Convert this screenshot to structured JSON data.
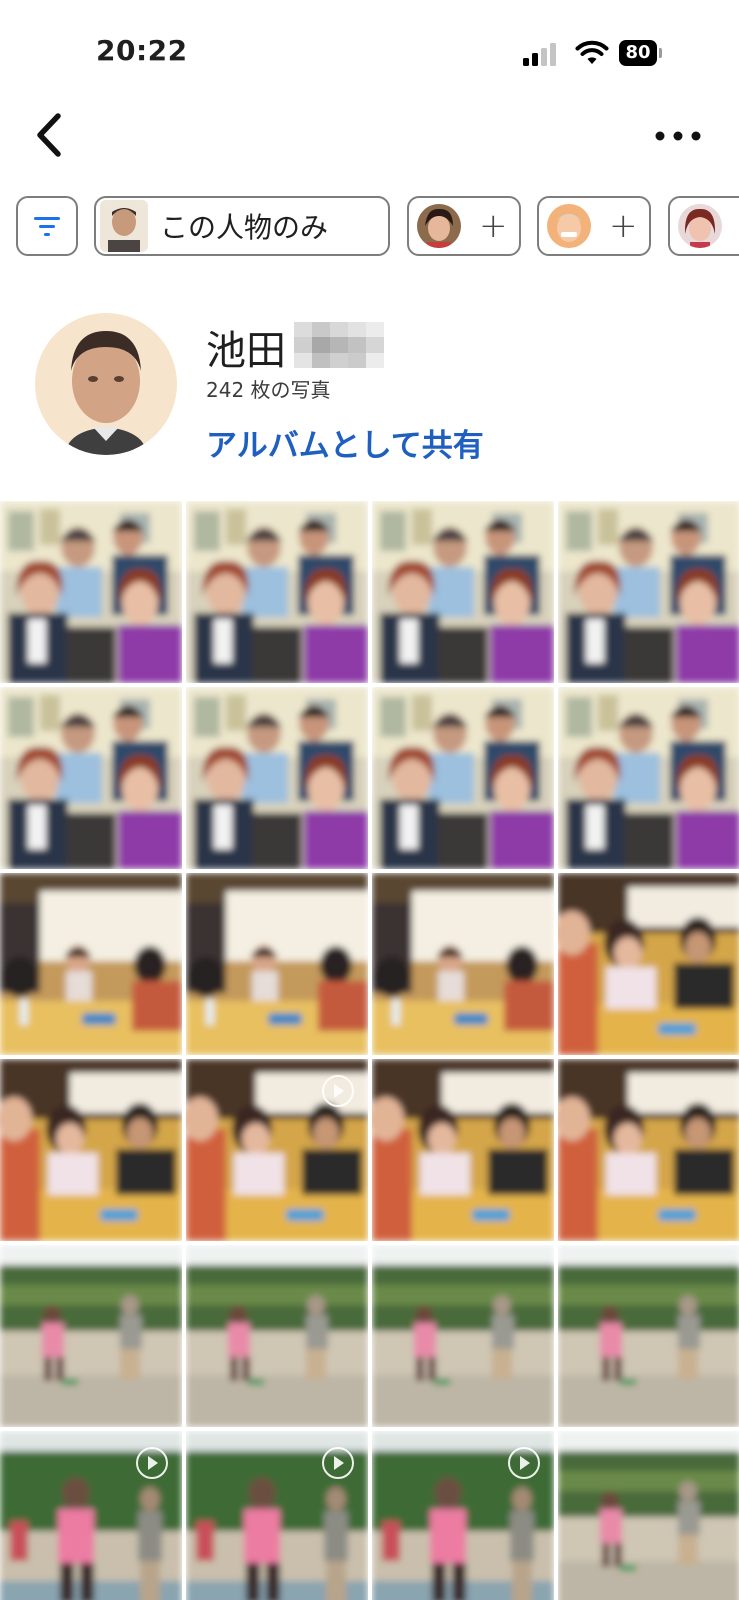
{
  "status_bar": {
    "time": "20:22",
    "battery": "80"
  },
  "filter_chips": {
    "only_this_person": "この人物のみ",
    "add_symbol": "+"
  },
  "person": {
    "name": "池田",
    "photo_count": "242 枚の写真",
    "share_action": "アルバムとして共有"
  },
  "colors": {
    "accent": "#1f5fbf",
    "chip_border": "#7d7d7d",
    "filter_icon": "#1a73e8"
  },
  "icons": [
    "back-chevron-icon",
    "more-dots-icon",
    "filter-icon",
    "wifi-icon",
    "signal-icon",
    "battery-icon",
    "play-video-icon"
  ],
  "photo_grid": {
    "rows": [
      [
        {
          "scene": "group-indoor",
          "video": false
        },
        {
          "scene": "group-indoor",
          "video": false
        },
        {
          "scene": "group-indoor",
          "video": false
        },
        {
          "scene": "group-indoor",
          "video": false
        }
      ],
      [
        {
          "scene": "group-indoor",
          "video": false
        },
        {
          "scene": "group-indoor",
          "video": false
        },
        {
          "scene": "group-indoor",
          "video": false
        },
        {
          "scene": "group-indoor",
          "video": false
        }
      ],
      [
        {
          "scene": "table-room",
          "video": false
        },
        {
          "scene": "table-room",
          "video": false
        },
        {
          "scene": "table-room",
          "video": false
        },
        {
          "scene": "kids-table",
          "video": false
        }
      ],
      [
        {
          "scene": "kids-table",
          "video": false
        },
        {
          "scene": "kids-table",
          "video": true
        },
        {
          "scene": "kids-table",
          "video": false
        },
        {
          "scene": "kids-table",
          "video": false
        }
      ],
      [
        {
          "scene": "river",
          "video": false
        },
        {
          "scene": "river",
          "video": false
        },
        {
          "scene": "river",
          "video": false
        },
        {
          "scene": "river",
          "video": false
        }
      ],
      [
        {
          "scene": "river-close",
          "video": true
        },
        {
          "scene": "river-close",
          "video": true
        },
        {
          "scene": "river-close",
          "video": true
        },
        {
          "scene": "river",
          "video": false
        }
      ]
    ]
  }
}
